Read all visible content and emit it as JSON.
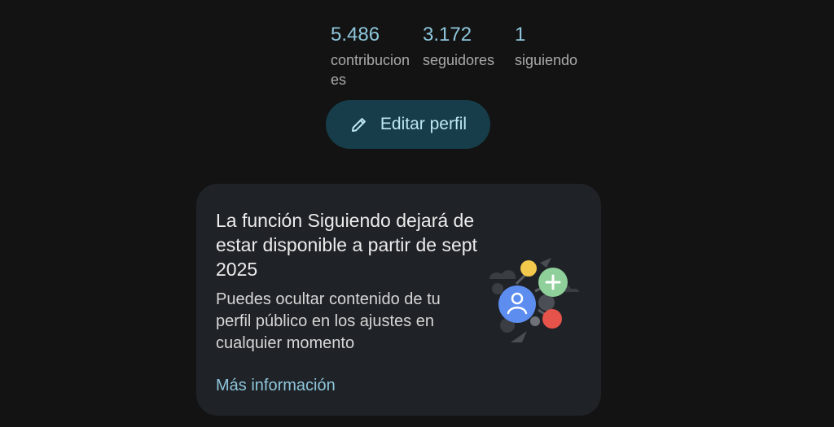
{
  "stats": [
    {
      "value": "5.486",
      "label": "contribuciones"
    },
    {
      "value": "3.172",
      "label": "seguidores"
    },
    {
      "value": "1",
      "label": "siguiendo"
    }
  ],
  "edit_profile": {
    "label": "Editar perfil",
    "icon": "pencil-icon"
  },
  "notice_card": {
    "title": "La función Siguiendo dejará de estar disponible a partir de sept 2025",
    "body": "Puedes ocultar contenido de tu perfil público en los ajustes en cualquier momento",
    "link": "Más información",
    "illustration": "social-connections-illustration"
  },
  "colors": {
    "background": "#131313",
    "card": "#1f2226",
    "accent": "#8ec6dc",
    "button_bg": "#163d49",
    "button_text": "#bde6f3"
  }
}
